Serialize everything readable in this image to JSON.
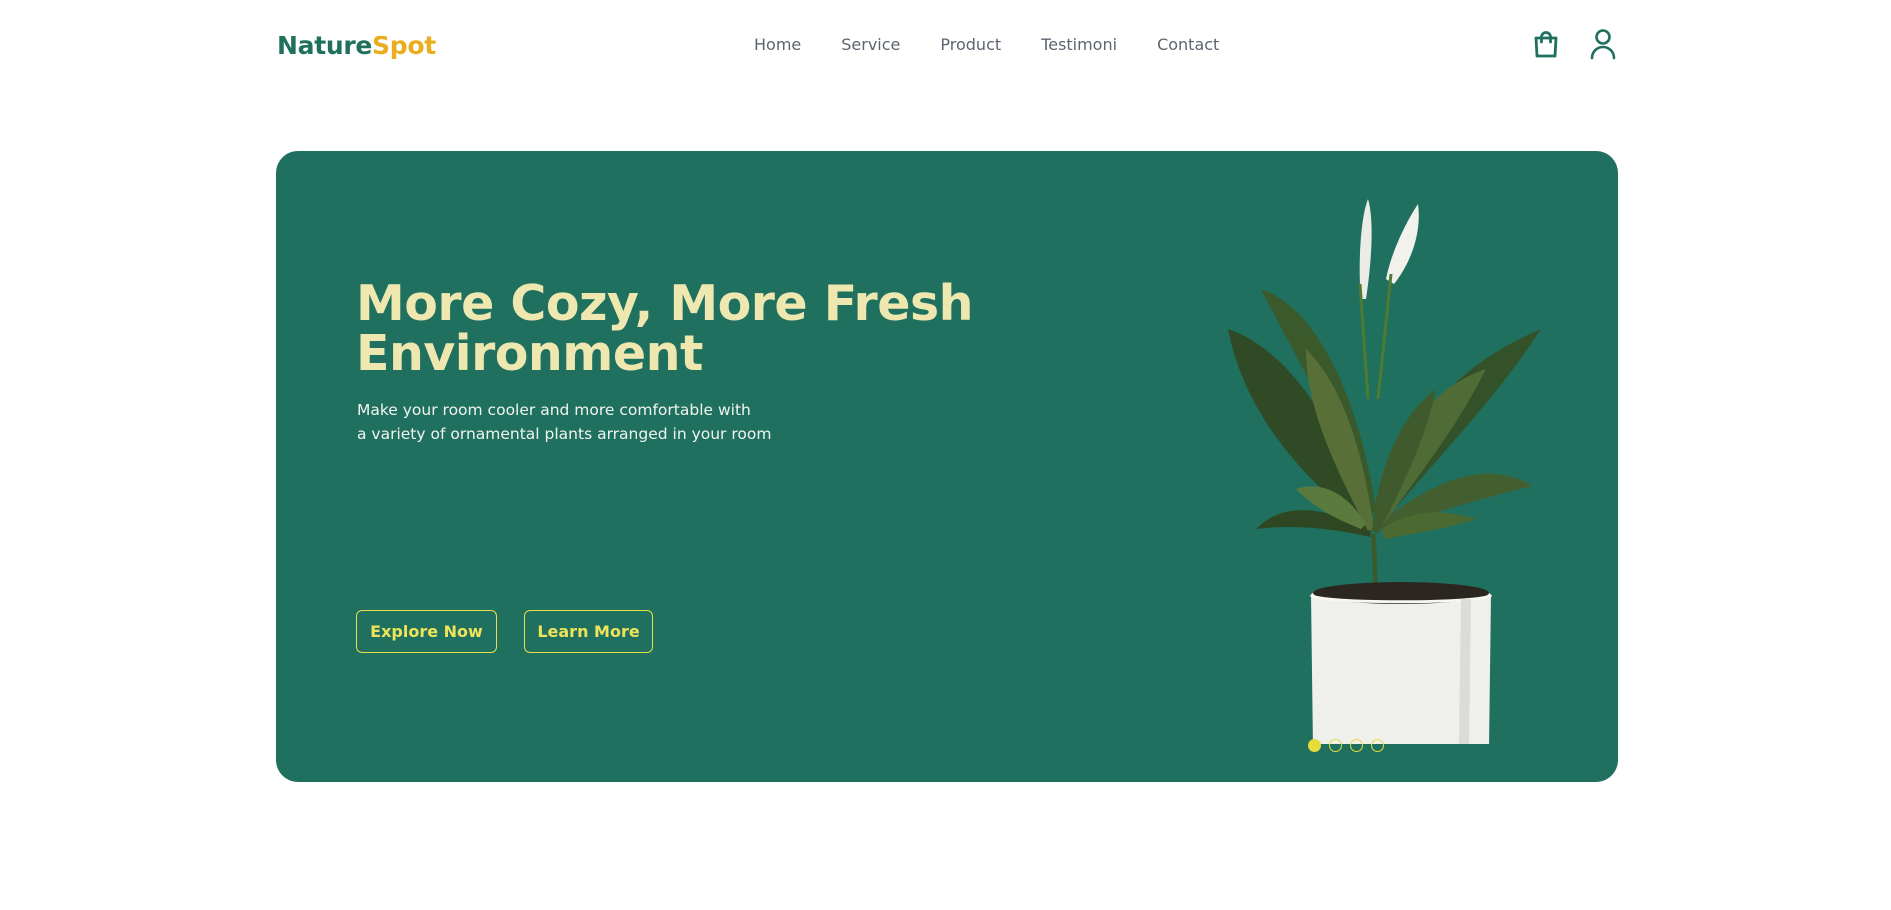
{
  "header": {
    "logo_part1": "Nature",
    "logo_part2": "Spot",
    "nav": [
      "Home",
      "Service",
      "Product",
      "Testimoni",
      "Contact"
    ],
    "icons": [
      "shopping-bag-icon",
      "user-icon"
    ]
  },
  "hero": {
    "title_line1": "More Cozy, More Fresh",
    "title_line2": "Environment",
    "subtitle_line1": "Make your room cooler and more comfortable with",
    "subtitle_line2": "a variety of ornamental plants arranged in your room",
    "explore_label": "Explore Now",
    "learn_label": "Learn More",
    "slides_total": 4,
    "active_slide": 1
  },
  "colors": {
    "brand_green": "#1f705e",
    "brand_gold": "#e9ad1e",
    "hero_title": "#efe7b0",
    "accent_yellow": "#e7dc3a"
  }
}
